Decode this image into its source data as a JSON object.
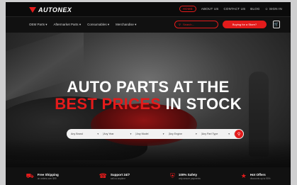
{
  "brand": {
    "name": "AUTONEX"
  },
  "toplinks": [
    "HOME",
    "ABOUT US",
    "CONTACT US",
    "BLOG",
    "SIGN IN"
  ],
  "menu": [
    "OEM Parts",
    "Aftermarket Parts",
    "Consumables",
    "Merchandise"
  ],
  "search": {
    "placeholder": "Search..."
  },
  "sell_label": "Buying for a Store?",
  "hero": {
    "line1": "AUTO PARTS AT THE",
    "line2_red": "BEST PRICES",
    "line2_white": " IN STOCK"
  },
  "finder": [
    "Any Brand",
    "Any Year",
    "Any Model",
    "Any Engine",
    "Any Part Type"
  ],
  "features": [
    {
      "title": "Free Shipping",
      "sub": "on orders over $99"
    },
    {
      "title": "Support 24/7",
      "sub": "call us anytime"
    },
    {
      "title": "100% Safety",
      "sub": "only secure payments"
    },
    {
      "title": "Hot Offers",
      "sub": "discounts up to 90%"
    }
  ],
  "colors": {
    "accent": "#e31b1b",
    "bg": "#111111"
  }
}
